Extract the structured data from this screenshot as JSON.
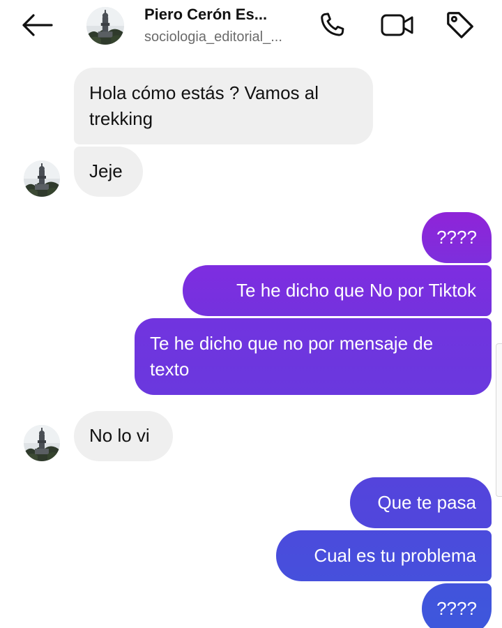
{
  "header": {
    "contact_name": "Piero Cerón Es...",
    "contact_username": "sociologia_editorial_...",
    "icons": {
      "back": "arrow-left-icon",
      "call": "phone-icon",
      "video": "video-camera-icon",
      "tag": "tag-icon"
    }
  },
  "colors": {
    "incoming_bubble": "#efefef",
    "outgoing_gradient_top": "#8a2be2",
    "outgoing_gradient_bottom": "#3b5bdb",
    "text_primary": "#111111",
    "text_secondary": "#6b6b6b"
  },
  "messages": [
    {
      "direction": "incoming",
      "line1": "Hola cómo estás ? Vamos al",
      "line2": "trekking"
    },
    {
      "direction": "incoming",
      "text": "Jeje"
    },
    {
      "direction": "outgoing",
      "text": "????"
    },
    {
      "direction": "outgoing",
      "text": "Te he dicho que No por Tiktok"
    },
    {
      "direction": "outgoing",
      "line1": "Te he dicho que no por mensaje de",
      "line2": "texto"
    },
    {
      "direction": "incoming",
      "text": "No lo vi"
    },
    {
      "direction": "outgoing",
      "text": "Que te pasa"
    },
    {
      "direction": "outgoing",
      "text": "Cual es tu problema"
    },
    {
      "direction": "outgoing",
      "text": "????"
    }
  ]
}
